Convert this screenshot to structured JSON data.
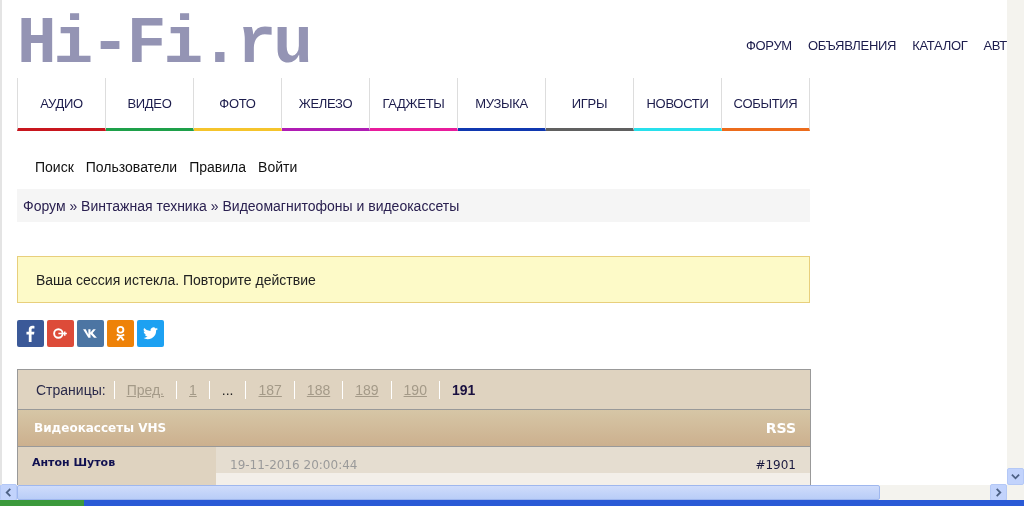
{
  "logo": {
    "text": "Hi-Fi.ru"
  },
  "top_nav": [
    "ФОРУМ",
    "ОБЪЯВЛЕНИЯ",
    "КАТАЛОГ",
    "АВТ"
  ],
  "categories": [
    {
      "label": "АУДИО",
      "color": "#c8161e"
    },
    {
      "label": "ВИДЕО",
      "color": "#1ea04a"
    },
    {
      "label": "ФОТО",
      "color": "#f5c42c"
    },
    {
      "label": "ЖЕЛЕЗО",
      "color": "#b01cb4"
    },
    {
      "label": "ГАДЖЕТЫ",
      "color": "#e81c9c"
    },
    {
      "label": "МУЗЫКА",
      "color": "#1038b0"
    },
    {
      "label": "ИГРЫ",
      "color": "#606060"
    },
    {
      "label": "НОВОСТИ",
      "color": "#28e0ec"
    },
    {
      "label": "СОБЫТИЯ",
      "color": "#ec6c1c"
    }
  ],
  "forum_nav": [
    "Поиск",
    "Пользователи",
    "Правила",
    "Войти"
  ],
  "breadcrumbs": {
    "separator": "»",
    "items": [
      "Форум",
      "Винтажная техника",
      "Видеомагнитофоны и видеокассеты"
    ]
  },
  "alert": {
    "text": "Ваша сессия истекла. Повторите действие"
  },
  "share_buttons": [
    {
      "kind": "facebook",
      "color": "#3b5998"
    },
    {
      "kind": "googleplus",
      "color": "#dd4b39"
    },
    {
      "kind": "vk",
      "color": "#4c75a3"
    },
    {
      "kind": "odnoklassniki",
      "color": "#ee8208"
    },
    {
      "kind": "twitter",
      "color": "#1da1f2"
    }
  ],
  "pagination": {
    "label": "Страницы:",
    "pages": [
      {
        "text": "Пред.",
        "selected": false
      },
      {
        "text": "1",
        "selected": false
      },
      {
        "text": "...",
        "kind": "gap",
        "selected": false
      },
      {
        "text": "187",
        "selected": false
      },
      {
        "text": "188",
        "selected": false
      },
      {
        "text": "189",
        "selected": false
      },
      {
        "text": "190",
        "selected": false
      },
      {
        "text": "191",
        "selected": true
      }
    ]
  },
  "topic": {
    "title": "Видеокассеты VHS",
    "rss": "RSS"
  },
  "posts": [
    {
      "author": "Антон Шутов",
      "date": "19-11-2016 20:00:44",
      "number": "#1901"
    }
  ]
}
